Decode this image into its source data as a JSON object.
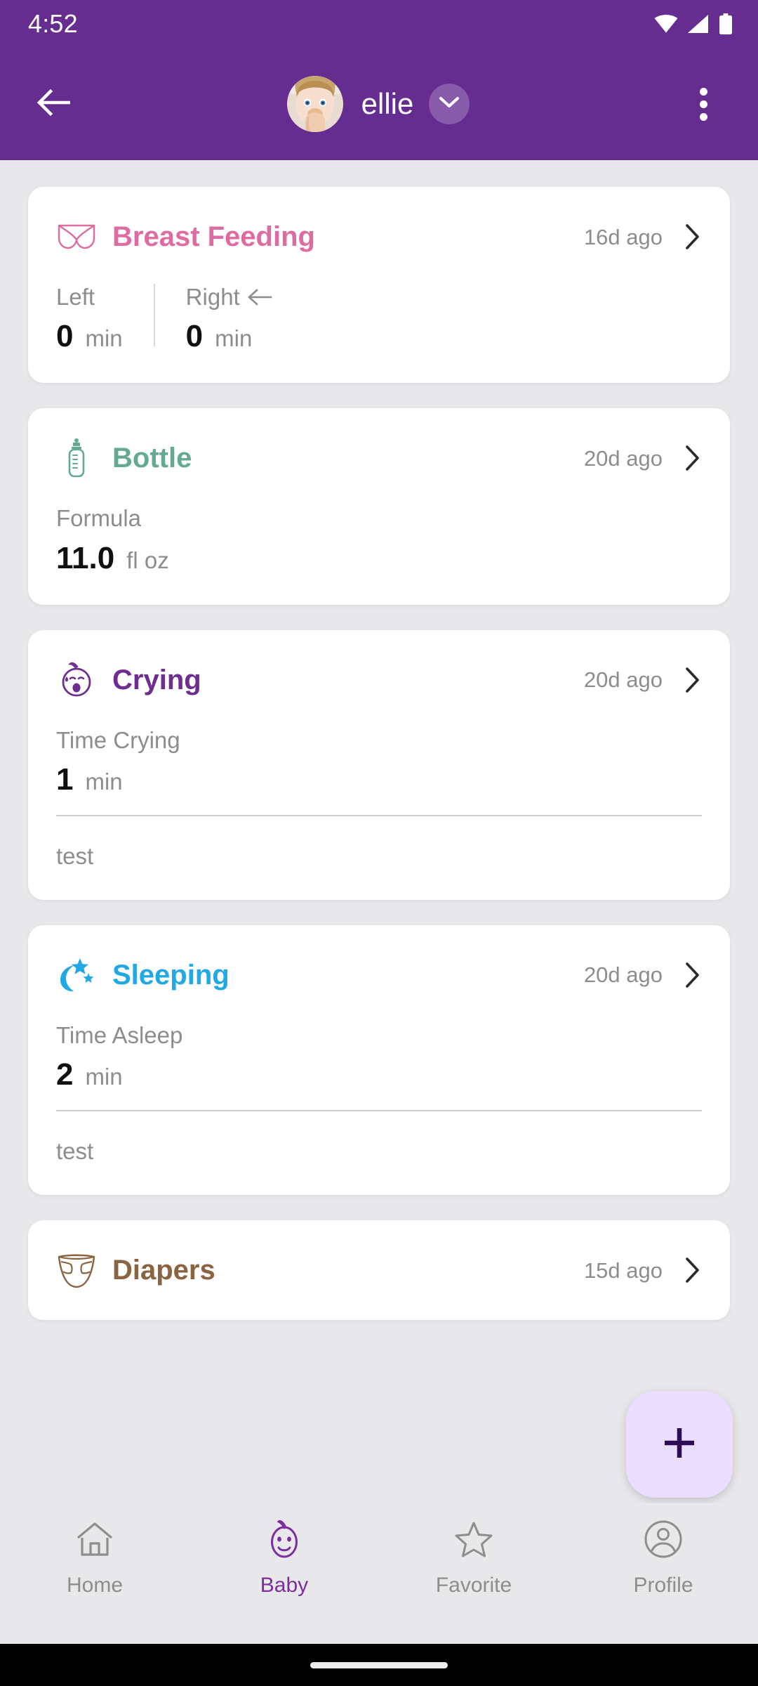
{
  "status_bar": {
    "time": "4:52",
    "icons": [
      "wifi-icon",
      "cell-signal-icon",
      "battery-icon"
    ]
  },
  "app_bar": {
    "back_icon": "arrow-back-icon",
    "baby_name": "ellie",
    "avatar": "baby-photo-avatar",
    "dropdown_icon": "chevron-down-icon",
    "overflow_icon": "more-vertical-icon",
    "background_color": "#662D91"
  },
  "cards": [
    {
      "id": "breast-feeding",
      "icon": "bra-icon",
      "title": "Breast Feeding",
      "color": "#DE6BA1",
      "ago": "16d ago",
      "chevron": "chevron-right-icon",
      "layout": "split",
      "columns": [
        {
          "label": "Left",
          "value": "0",
          "unit": "min",
          "marker": ""
        },
        {
          "label": "Right",
          "value": "0",
          "unit": "min",
          "marker": "arrow-left-icon"
        }
      ]
    },
    {
      "id": "bottle",
      "icon": "baby-bottle-icon",
      "title": "Bottle",
      "color": "#63A994",
      "ago": "20d ago",
      "chevron": "chevron-right-icon",
      "layout": "single",
      "metric_label": "Formula",
      "metric_value": "11.0",
      "metric_unit": "fl oz"
    },
    {
      "id": "crying",
      "icon": "crying-baby-icon",
      "title": "Crying",
      "color": "#6F2C91",
      "ago": "20d ago",
      "chevron": "chevron-right-icon",
      "layout": "single-note",
      "metric_label": "Time Crying",
      "metric_value": "1",
      "metric_unit": "min",
      "note": "test"
    },
    {
      "id": "sleeping",
      "icon": "moon-stars-icon",
      "title": "Sleeping",
      "color": "#20A9E5",
      "ago": "20d ago",
      "chevron": "chevron-right-icon",
      "layout": "single-note",
      "metric_label": "Time Asleep",
      "metric_value": "2",
      "metric_unit": "min",
      "note": "test"
    },
    {
      "id": "diapers",
      "icon": "diaper-icon",
      "title": "Diapers",
      "color": "#8A6341",
      "ago": "15d ago",
      "chevron": "chevron-right-icon",
      "layout": "clipped"
    }
  ],
  "fab": {
    "icon": "plus-icon",
    "background_color": "#EADDFD",
    "icon_color": "#2E0B57"
  },
  "bottom_nav": {
    "active": "Baby",
    "active_color": "#7B2E9D",
    "inactive_color": "#8D8D8D",
    "items": [
      {
        "label": "Home",
        "icon": "home-icon"
      },
      {
        "label": "Baby",
        "icon": "baby-face-icon"
      },
      {
        "label": "Favorite",
        "icon": "star-icon"
      },
      {
        "label": "Profile",
        "icon": "account-circle-icon"
      }
    ]
  },
  "gesture_bar": {
    "indicator": "home-gesture-pill"
  }
}
